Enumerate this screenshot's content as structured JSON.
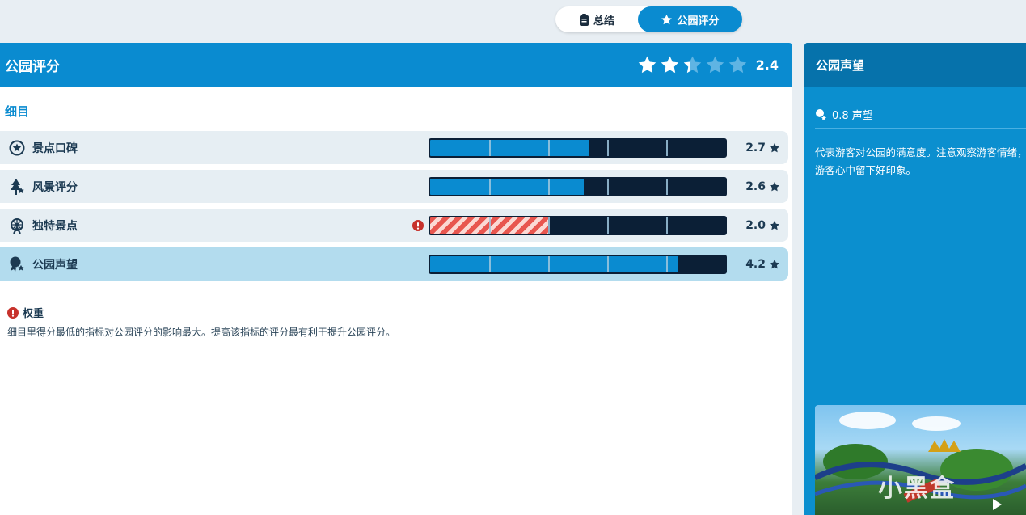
{
  "tabs": {
    "summary_label": "总结",
    "rating_label": "公园评分"
  },
  "main": {
    "title": "公园评分",
    "rating": "2.4",
    "rating_stars": 2.4,
    "section_label": "细目",
    "rows": [
      {
        "label": "景点口碑",
        "score": "2.7",
        "fill": 0.54,
        "icon": "attraction-badge-icon",
        "alert": false,
        "active": false
      },
      {
        "label": "风景评分",
        "score": "2.6",
        "fill": 0.52,
        "icon": "tree-icon",
        "alert": false,
        "active": false
      },
      {
        "label": "独特景点",
        "score": "2.0",
        "fill": 0.4,
        "icon": "ferris-wheel-icon",
        "alert": true,
        "active": false
      },
      {
        "label": "公园声望",
        "score": "4.2",
        "fill": 0.84,
        "icon": "reputation-icon",
        "alert": false,
        "active": true
      }
    ],
    "weight_title": "权重",
    "weight_text": "细目里得分最低的指标对公园评分的影响最大。提高该指标的评分最有利于提升公园评分。"
  },
  "side": {
    "title": "公园声望",
    "stat": "0.8 声望",
    "description": "代表游客对公园的满意度。注意观察游客情绪，在游客心中留下好印象。",
    "watermark": "小黑盒"
  },
  "colors": {
    "accent": "#0a8bd0",
    "bar_track": "#0b1f36",
    "warning": "#e8564f"
  }
}
